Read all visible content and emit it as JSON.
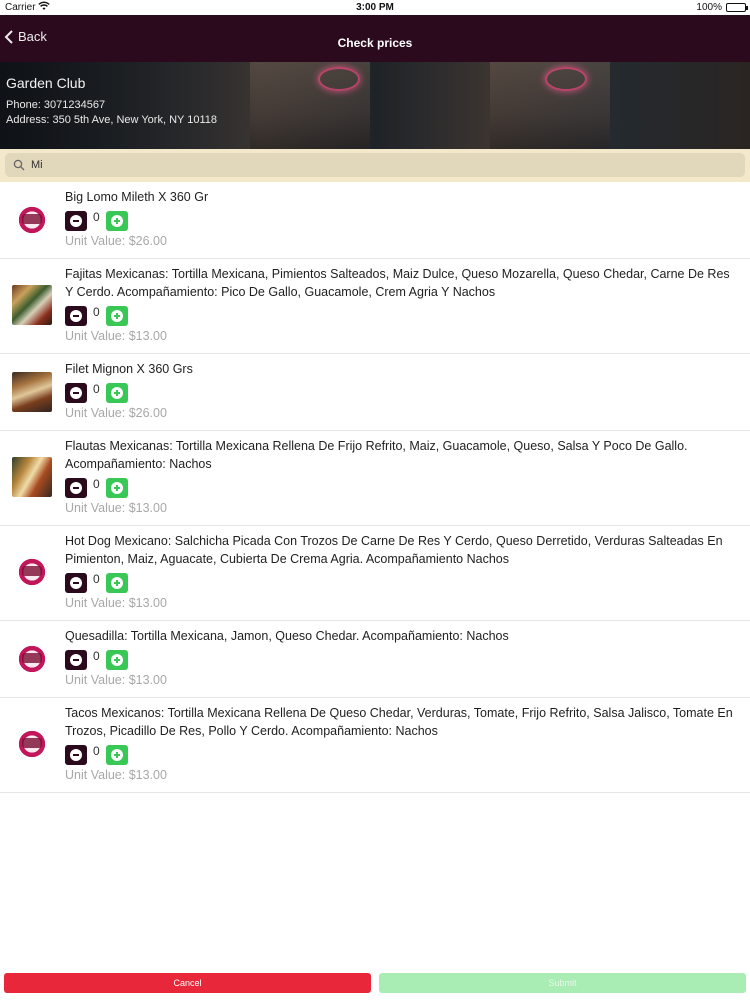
{
  "status_bar": {
    "carrier": "Carrier",
    "time": "3:00 PM",
    "battery": "100%"
  },
  "nav": {
    "back_label": "Back",
    "title": "Check prices"
  },
  "venue": {
    "name": "Garden Club",
    "phone": "Phone: 3071234567",
    "address": "Address: 350 5th Ave, New York, NY 10118"
  },
  "search": {
    "value": "Mi",
    "placeholder": ""
  },
  "items": [
    {
      "name": "Big Lomo Mileth X 360 Gr",
      "qty": "0",
      "unit": "Unit Value: $26.00",
      "image": "logo"
    },
    {
      "name": "Fajitas Mexicanas: Tortilla Mexicana, Pimientos Salteados, Maiz Dulce, Queso Mozarella, Queso Chedar, Carne De Res Y Cerdo. Acompañamiento: Pico De Gallo, Guacamole, Crem Agria Y Nachos",
      "qty": "0",
      "unit": "Unit Value: $13.00",
      "image": "photo"
    },
    {
      "name": "Filet Mignon X 360 Grs",
      "qty": "0",
      "unit": "Unit Value: $26.00",
      "image": "photo"
    },
    {
      "name": "Flautas Mexicanas: Tortilla Mexicana Rellena De Frijo Refrito, Maiz, Guacamole, Queso, Salsa Y Poco De Gallo. Acompañamiento: Nachos",
      "qty": "0",
      "unit": "Unit Value: $13.00",
      "image": "photo"
    },
    {
      "name": "Hot Dog Mexicano: Salchicha Picada Con Trozos De Carne De Res Y Cerdo, Queso Derretido, Verduras Salteadas En Pimienton, Maiz, Aguacate, Cubierta De Crema Agria. Acompañamiento Nachos",
      "qty": "0",
      "unit": "Unit Value: $13.00",
      "image": "logo"
    },
    {
      "name": "Quesadilla: Tortilla Mexicana, Jamon, Queso Chedar. Acompañamiento: Nachos",
      "qty": "0",
      "unit": "Unit Value: $13.00",
      "image": "logo"
    },
    {
      "name": "Tacos Mexicanos: Tortilla Mexicana Rellena De Queso Chedar, Verduras, Tomate, Frijo Refrito, Salsa Jalisco, Tomate En Trozos, Picadillo De Res, Pollo Y Cerdo. Acompañamiento: Nachos",
      "qty": "0",
      "unit": "Unit Value: $13.00",
      "image": "logo"
    }
  ],
  "actions": {
    "cancel_label": "Cancel",
    "submit_label": "Submit"
  },
  "colors": {
    "nav_bg": "#2b0a1e",
    "minus_btn": "#2b0a1e",
    "plus_btn": "#39c855",
    "cancel": "#e8283a",
    "submit": "#a9ecb4",
    "search_bg": "#f3e8c9"
  }
}
